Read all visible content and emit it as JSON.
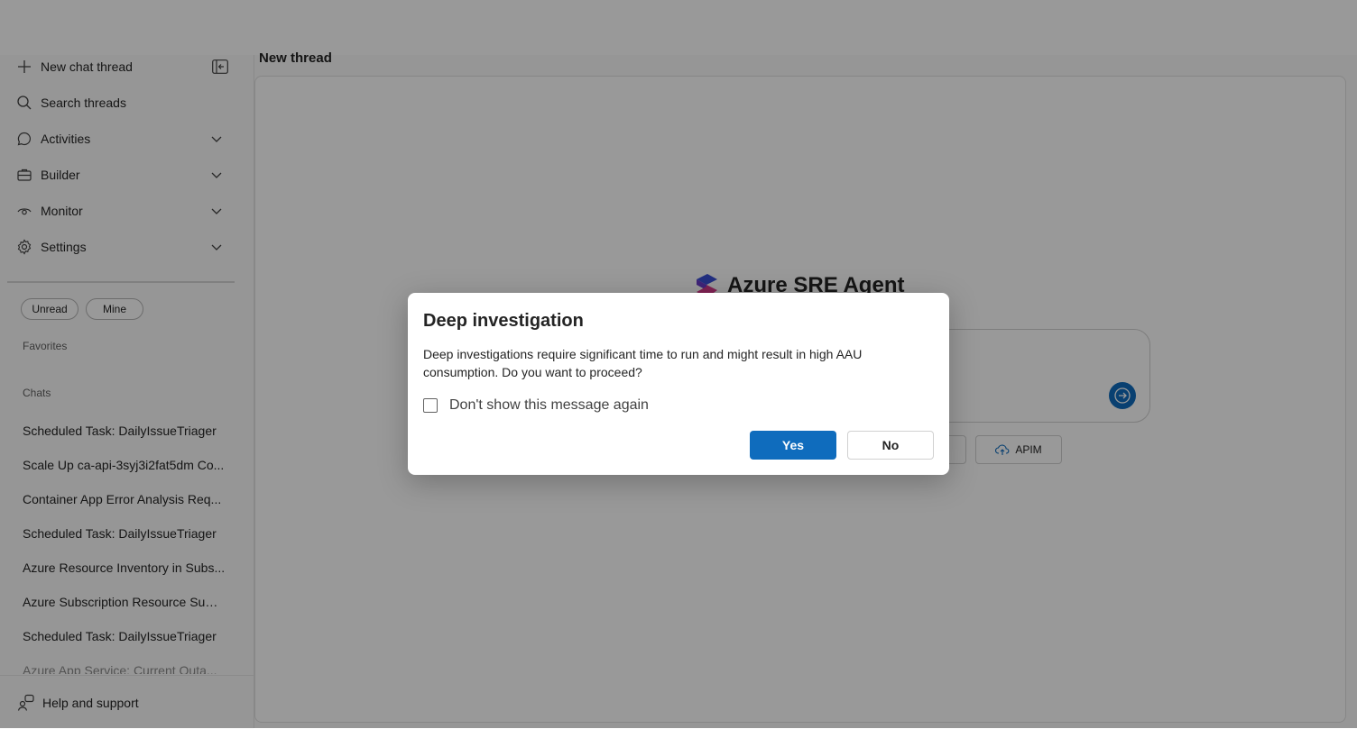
{
  "sidebar": {
    "new_thread": "New chat thread",
    "search": "Search threads",
    "nav": [
      {
        "label": "Activities",
        "icon": "chat-bubble-icon"
      },
      {
        "label": "Builder",
        "icon": "briefcase-icon"
      },
      {
        "label": "Monitor",
        "icon": "eye-icon"
      },
      {
        "label": "Settings",
        "icon": "gear-icon"
      }
    ],
    "filters": {
      "unread": "Unread",
      "mine": "Mine"
    },
    "favorites_label": "Favorites",
    "chats_label": "Chats",
    "chats": [
      "Scheduled Task: DailyIssueTriager",
      "Scale Up ca-api-3syj3i2fat5dm Co...",
      "Container App Error Analysis Req...",
      "Scheduled Task: DailyIssueTriager",
      "Azure Resource Inventory in Subs...",
      "Azure Subscription Resource Sum...",
      "Scheduled Task: DailyIssueTriager",
      "Azure App Service: Current Outa..."
    ],
    "help": "Help and support"
  },
  "main": {
    "title": "New thread",
    "brand": "Azure SRE Agent",
    "chip_apim": "APIM"
  },
  "dialog": {
    "title": "Deep investigation",
    "body": "Deep investigations require significant time to run and might result in high AAU consumption. Do you want to proceed?",
    "checkbox_label": "Don't show this message again",
    "checkbox_checked": false,
    "yes": "Yes",
    "no": "No"
  },
  "colors": {
    "accent": "#0f6cbd",
    "overlay": "rgba(0,0,0,0.4)"
  }
}
